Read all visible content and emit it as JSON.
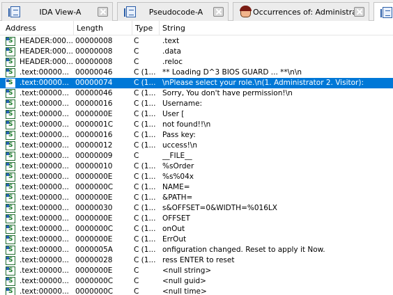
{
  "tabs": [
    {
      "label": "IDA View-A",
      "icon": "doc-icon"
    },
    {
      "label": "Pseudocode-A",
      "icon": "doc-icon"
    },
    {
      "label": "Occurrences of: Administrator",
      "icon": "face-icon"
    },
    {
      "label": "S",
      "icon": "doc-icon"
    }
  ],
  "columns": {
    "address": "Address",
    "length": "Length",
    "type": "Type",
    "string": "String"
  },
  "selected_row_index": 4,
  "rows": [
    {
      "address": "HEADER:000...",
      "length": "00000008",
      "type": "C",
      "string": ".text"
    },
    {
      "address": "HEADER:000...",
      "length": "00000008",
      "type": "C",
      "string": ".data"
    },
    {
      "address": "HEADER:000...",
      "length": "00000008",
      "type": "C",
      "string": ".reloc"
    },
    {
      "address": ".text:00000...",
      "length": "00000046",
      "type": "C (1...",
      "string": "** Loading D^3 BIOS GUARD ... **\\n\\n"
    },
    {
      "address": ".text:00000...",
      "length": "00000074",
      "type": "C (1...",
      "string": "\\nPlease select your role.\\n(1. Administrator 2. Visitor):"
    },
    {
      "address": ".text:00000...",
      "length": "00000046",
      "type": "C (1...",
      "string": "Sorry, You don't have permission!\\n"
    },
    {
      "address": ".text:00000...",
      "length": "00000016",
      "type": "C (1...",
      "string": "Username:"
    },
    {
      "address": ".text:00000...",
      "length": "0000000E",
      "type": "C (1...",
      "string": "User ["
    },
    {
      "address": ".text:00000...",
      "length": "0000001C",
      "type": "C (1...",
      "string": " not found!!\\n"
    },
    {
      "address": ".text:00000...",
      "length": "00000016",
      "type": "C (1...",
      "string": "Pass key:"
    },
    {
      "address": ".text:00000...",
      "length": "00000012",
      "type": "C (1...",
      "string": "uccess!\\n"
    },
    {
      "address": ".text:00000...",
      "length": "00000009",
      "type": "C",
      "string": "__FILE__"
    },
    {
      "address": ".text:00000...",
      "length": "00000010",
      "type": "C (1...",
      "string": "%sOrder"
    },
    {
      "address": ".text:00000...",
      "length": "0000000E",
      "type": "C (1...",
      "string": "%s%04x"
    },
    {
      "address": ".text:00000...",
      "length": "0000000C",
      "type": "C (1...",
      "string": "NAME="
    },
    {
      "address": ".text:00000...",
      "length": "0000000E",
      "type": "C (1...",
      "string": "&PATH="
    },
    {
      "address": ".text:00000...",
      "length": "00000030",
      "type": "C (1...",
      "string": "s&OFFSET=0&WIDTH=%016LX"
    },
    {
      "address": ".text:00000...",
      "length": "0000000E",
      "type": "C (1...",
      "string": "OFFSET"
    },
    {
      "address": ".text:00000...",
      "length": "0000000C",
      "type": "C (1...",
      "string": "onOut"
    },
    {
      "address": ".text:00000...",
      "length": "0000000E",
      "type": "C (1...",
      "string": "ErrOut"
    },
    {
      "address": ".text:00000...",
      "length": "0000005A",
      "type": "C (1...",
      "string": "onfiguration changed. Reset to apply it Now."
    },
    {
      "address": ".text:00000...",
      "length": "00000028",
      "type": "C (1...",
      "string": "ress ENTER to reset"
    },
    {
      "address": ".text:00000...",
      "length": "0000000E",
      "type": "C",
      "string": "<null string>"
    },
    {
      "address": ".text:00000...",
      "length": "0000000C",
      "type": "C",
      "string": "<null guid>"
    },
    {
      "address": ".text:00000...",
      "length": "0000000C",
      "type": "C",
      "string": "<null time>"
    }
  ]
}
